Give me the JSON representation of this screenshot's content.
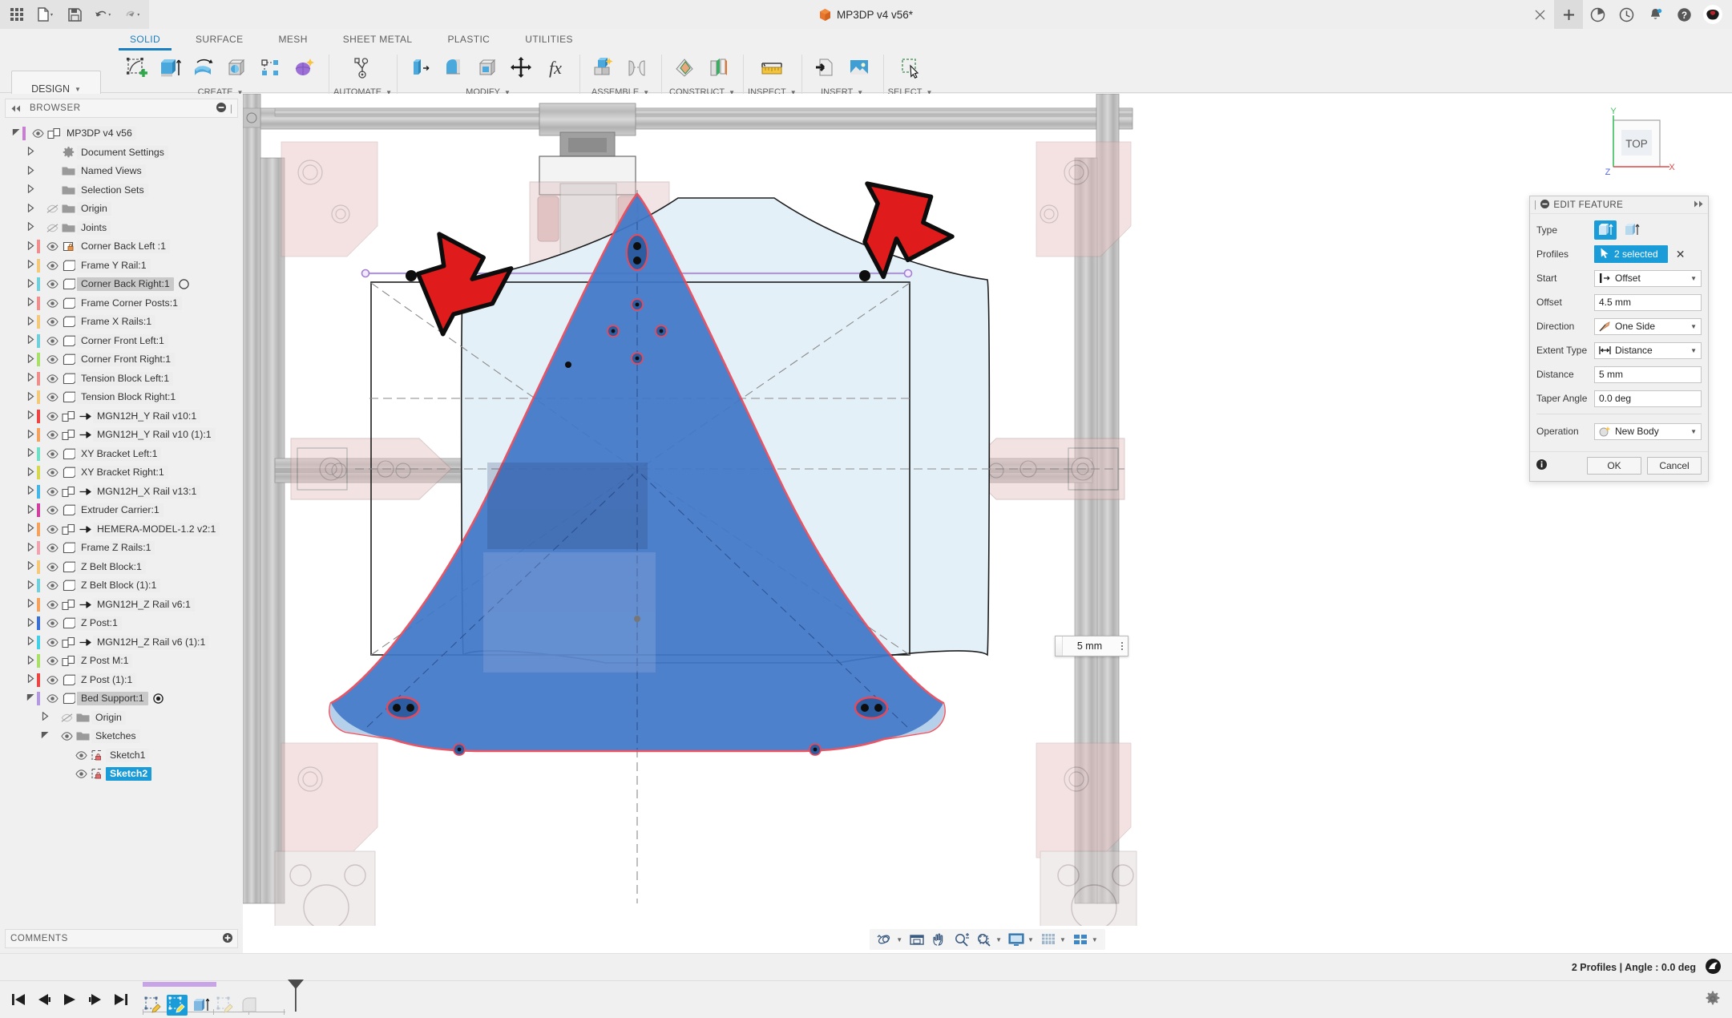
{
  "window": {
    "document_title": "MP3DP v4 v56*",
    "quick_access": [
      {
        "name": "app-grid-icon",
        "label": "Apps"
      },
      {
        "name": "new-file-icon",
        "label": "New"
      },
      {
        "name": "save-icon",
        "label": "Save"
      },
      {
        "name": "undo-icon",
        "label": "Undo"
      },
      {
        "name": "redo-icon",
        "label": "Redo"
      }
    ],
    "controls": [
      {
        "name": "close-tab-button",
        "label": "×"
      },
      {
        "name": "new-tab-button",
        "label": "+"
      },
      {
        "name": "job-status-icon",
        "label": "Job Status"
      },
      {
        "name": "recent-icon",
        "label": "Recent"
      },
      {
        "name": "notifications-icon",
        "label": "Notifications"
      },
      {
        "name": "help-icon",
        "label": "Help"
      },
      {
        "name": "account-avatar",
        "label": "Account"
      }
    ]
  },
  "ribbon": {
    "design_label": "DESIGN",
    "tabs": [
      {
        "label": "SOLID",
        "active": true
      },
      {
        "label": "SURFACE",
        "active": false
      },
      {
        "label": "MESH",
        "active": false
      },
      {
        "label": "SHEET METAL",
        "active": false
      },
      {
        "label": "PLASTIC",
        "active": false
      },
      {
        "label": "UTILITIES",
        "active": false
      }
    ],
    "panels": [
      {
        "label": "CREATE",
        "items": [
          "create-sketch-icon",
          "extrude-icon",
          "revolve-icon",
          "sweep-icon",
          "pattern-icon",
          "form-icon"
        ]
      },
      {
        "label": "AUTOMATE",
        "items": [
          "automate-icon"
        ]
      },
      {
        "label": "MODIFY",
        "items": [
          "press-pull-icon",
          "fillet-icon",
          "shell-icon",
          "move-copy-icon",
          "change-parameters-icon"
        ]
      },
      {
        "label": "ASSEMBLE",
        "items": [
          "new-component-icon",
          "joint-icon"
        ]
      },
      {
        "label": "CONSTRUCT",
        "items": [
          "offset-plane-icon",
          "plane-at-angle-icon"
        ]
      },
      {
        "label": "INSPECT",
        "items": [
          "measure-icon"
        ]
      },
      {
        "label": "INSERT",
        "items": [
          "insert-derive-icon",
          "insert-canvas-icon"
        ]
      },
      {
        "label": "SELECT",
        "items": [
          "select-window-icon"
        ]
      }
    ]
  },
  "browser": {
    "header_label": "BROWSER",
    "collapse_icon": "collapse-left-icon",
    "minus_icon": "minus-circle-icon",
    "items": [
      {
        "label": "MP3DP v4 v56",
        "indent": 0,
        "arrow": "down",
        "color": "#c77fd0",
        "eye": true,
        "icon": "component-icon",
        "badge": null,
        "state": "normal"
      },
      {
        "label": "Document Settings",
        "indent": 1,
        "arrow": "right",
        "color": null,
        "eye": false,
        "icon": "gear-icon",
        "badge": null,
        "state": "normal"
      },
      {
        "label": "Named Views",
        "indent": 1,
        "arrow": "right",
        "color": null,
        "eye": false,
        "icon": "folder-icon",
        "badge": null,
        "state": "normal"
      },
      {
        "label": "Selection Sets",
        "indent": 1,
        "arrow": "right",
        "color": null,
        "eye": false,
        "icon": "folder-icon",
        "badge": null,
        "state": "normal"
      },
      {
        "label": "Origin",
        "indent": 1,
        "arrow": "right",
        "color": null,
        "eye": "off",
        "icon": "folder-icon",
        "badge": null,
        "state": "normal"
      },
      {
        "label": "Joints",
        "indent": 1,
        "arrow": "right",
        "color": null,
        "eye": "off",
        "icon": "folder-icon",
        "badge": null,
        "state": "normal"
      },
      {
        "label": "Corner Back Left :1",
        "indent": 1,
        "arrow": "right",
        "color": "#f08d8d",
        "eye": true,
        "icon": "body-locked-icon",
        "badge": null,
        "state": "normal"
      },
      {
        "label": "Frame Y Rail:1",
        "indent": 1,
        "arrow": "right",
        "color": "#f5c97a",
        "eye": true,
        "icon": "body-icon",
        "badge": null,
        "state": "normal"
      },
      {
        "label": "Corner Back Right:1",
        "indent": 1,
        "arrow": "right",
        "color": "#6fd0dd",
        "eye": true,
        "icon": "body-icon",
        "badge": "circle",
        "state": "sel"
      },
      {
        "label": "Frame Corner Posts:1",
        "indent": 1,
        "arrow": "right",
        "color": "#f08d8d",
        "eye": true,
        "icon": "body-icon",
        "badge": null,
        "state": "normal"
      },
      {
        "label": "Frame X Rails:1",
        "indent": 1,
        "arrow": "right",
        "color": "#f5c97a",
        "eye": true,
        "icon": "body-icon",
        "badge": null,
        "state": "normal"
      },
      {
        "label": "Corner Front Left:1",
        "indent": 1,
        "arrow": "right",
        "color": "#6fd0dd",
        "eye": true,
        "icon": "body-icon",
        "badge": null,
        "state": "normal"
      },
      {
        "label": "Corner Front Right:1",
        "indent": 1,
        "arrow": "right",
        "color": "#a8e06a",
        "eye": true,
        "icon": "body-icon",
        "badge": null,
        "state": "normal"
      },
      {
        "label": "Tension Block Left:1",
        "indent": 1,
        "arrow": "right",
        "color": "#f08d8d",
        "eye": true,
        "icon": "body-icon",
        "badge": null,
        "state": "normal"
      },
      {
        "label": "Tension Block Right:1",
        "indent": 1,
        "arrow": "right",
        "color": "#f5c97a",
        "eye": true,
        "icon": "body-icon",
        "badge": null,
        "state": "normal"
      },
      {
        "label": "MGN12H_Y Rail v10:1",
        "indent": 1,
        "arrow": "right",
        "color": "#ef4444",
        "eye": true,
        "icon": "component-icon",
        "badge": "joint",
        "state": "normal"
      },
      {
        "label": "MGN12H_Y Rail v10 (1):1",
        "indent": 1,
        "arrow": "right",
        "color": "#f5a25d",
        "eye": true,
        "icon": "component-icon",
        "badge": "joint",
        "state": "normal"
      },
      {
        "label": "XY Bracket Left:1",
        "indent": 1,
        "arrow": "right",
        "color": "#6fe0c8",
        "eye": true,
        "icon": "body-icon",
        "badge": null,
        "state": "normal"
      },
      {
        "label": "XY Bracket Right:1",
        "indent": 1,
        "arrow": "right",
        "color": "#d6d84e",
        "eye": true,
        "icon": "body-icon",
        "badge": null,
        "state": "normal"
      },
      {
        "label": "MGN12H_X Rail v13:1",
        "indent": 1,
        "arrow": "right",
        "color": "#44b6e8",
        "eye": true,
        "icon": "component-icon",
        "badge": "joint",
        "state": "normal"
      },
      {
        "label": "Extruder Carrier:1",
        "indent": 1,
        "arrow": "right",
        "color": "#d13fa0",
        "eye": true,
        "icon": "body-icon",
        "badge": null,
        "state": "normal"
      },
      {
        "label": "HEMERA-MODEL-1.2 v2:1",
        "indent": 1,
        "arrow": "right",
        "color": "#f5a25d",
        "eye": true,
        "icon": "component-icon",
        "badge": "joint",
        "state": "normal"
      },
      {
        "label": "Frame Z Rails:1",
        "indent": 1,
        "arrow": "right",
        "color": "#f2a3b0",
        "eye": true,
        "icon": "body-icon",
        "badge": null,
        "state": "normal"
      },
      {
        "label": "Z Belt Block:1",
        "indent": 1,
        "arrow": "right",
        "color": "#f5c97a",
        "eye": true,
        "icon": "body-icon",
        "badge": null,
        "state": "normal"
      },
      {
        "label": "Z Belt Block (1):1",
        "indent": 1,
        "arrow": "right",
        "color": "#6fd0dd",
        "eye": true,
        "icon": "body-icon",
        "badge": null,
        "state": "normal"
      },
      {
        "label": "MGN12H_Z Rail v6:1",
        "indent": 1,
        "arrow": "right",
        "color": "#f5a25d",
        "eye": true,
        "icon": "component-icon",
        "badge": "joint",
        "state": "normal"
      },
      {
        "label": "Z Post:1",
        "indent": 1,
        "arrow": "right",
        "color": "#3b6fd4",
        "eye": true,
        "icon": "body-icon",
        "badge": null,
        "state": "normal"
      },
      {
        "label": "MGN12H_Z Rail v6 (1):1",
        "indent": 1,
        "arrow": "right",
        "color": "#44cfe8",
        "eye": true,
        "icon": "component-icon",
        "badge": "joint",
        "state": "normal"
      },
      {
        "label": "Z Post M:1",
        "indent": 1,
        "arrow": "right",
        "color": "#a8e06a",
        "eye": true,
        "icon": "component-icon",
        "badge": null,
        "state": "normal"
      },
      {
        "label": "Z Post (1):1",
        "indent": 1,
        "arrow": "right",
        "color": "#ef4444",
        "eye": true,
        "icon": "body-icon",
        "badge": null,
        "state": "normal"
      },
      {
        "label": "Bed Support:1",
        "indent": 1,
        "arrow": "down",
        "color": "#b39ae0",
        "eye": true,
        "icon": "body-icon",
        "badge": "target",
        "state": "sel"
      },
      {
        "label": "Origin",
        "indent": 2,
        "arrow": "right",
        "color": null,
        "eye": "off",
        "icon": "folder-icon",
        "badge": null,
        "state": "normal"
      },
      {
        "label": "Sketches",
        "indent": 2,
        "arrow": "down",
        "color": null,
        "eye": true,
        "icon": "folder-icon",
        "badge": null,
        "state": "normal"
      },
      {
        "label": "Sketch1",
        "indent": 3,
        "arrow": "none",
        "color": null,
        "eye": true,
        "icon": "sketch-icon",
        "badge": null,
        "state": "normal"
      },
      {
        "label": "Sketch2",
        "indent": 3,
        "arrow": "none",
        "color": null,
        "eye": true,
        "icon": "sketch-icon",
        "badge": null,
        "state": "selblue"
      }
    ],
    "comments_label": "COMMENTS",
    "comments_add_icon": "plus-circle-icon"
  },
  "dialog": {
    "title": "EDIT FEATURE",
    "collapse_icon": "minus-circle-icon",
    "expand_icon": "chevrons-right-icon",
    "type_label": "Type",
    "type_options": [
      "extrude-profile-icon",
      "extrude-surface-icon"
    ],
    "type_selected_index": 0,
    "profiles_label": "Profiles",
    "profiles_value": "2 selected",
    "profiles_clear_icon": "x-icon",
    "start_label": "Start",
    "start_value": "Offset",
    "start_icon": "start-offset-icon",
    "offset_label": "Offset",
    "offset_value": "4.5 mm",
    "direction_label": "Direction",
    "direction_value": "One Side",
    "direction_icon": "direction-one-side-icon",
    "extent_type_label": "Extent Type",
    "extent_type_value": "Distance",
    "extent_type_icon": "distance-icon",
    "distance_label": "Distance",
    "distance_value": "5 mm",
    "taper_label": "Taper Angle",
    "taper_value": "0.0 deg",
    "operation_label": "Operation",
    "operation_value": "New Body",
    "operation_icon": "new-body-icon",
    "info_icon": "info-icon",
    "ok_label": "OK",
    "cancel_label": "Cancel"
  },
  "canvas": {
    "viewcube_face": "TOP",
    "axis_x": "X",
    "axis_y": "Y",
    "axis_z": "Z",
    "dimension_value": "5 mm",
    "annotations": [
      {
        "name": "red-arrow-left",
        "direction": "down-right"
      },
      {
        "name": "red-arrow-right",
        "direction": "down-left"
      }
    ],
    "colors": {
      "selected_face": "#4178c8",
      "profile_highlight": "#e8495a",
      "preview_face": "#e4f0f8",
      "sketch_line": "#b09ad6",
      "annotation_arrow": "#e01b1b"
    }
  },
  "nav_toolbar": {
    "items": [
      {
        "name": "orbit-icon",
        "label": "Orbit",
        "dropdown": true
      },
      {
        "name": "pan-view-icon",
        "label": "Look At",
        "dropdown": false
      },
      {
        "name": "pan-icon",
        "label": "Pan",
        "dropdown": false
      },
      {
        "name": "zoom-icon",
        "label": "Zoom",
        "dropdown": false
      },
      {
        "name": "zoom-window-icon",
        "label": "Fit",
        "dropdown": true
      },
      {
        "name": "display-settings-icon",
        "label": "Display Settings",
        "dropdown": true
      },
      {
        "name": "grid-snaps-icon",
        "label": "Grid and Snaps",
        "dropdown": true
      },
      {
        "name": "viewports-icon",
        "label": "Viewports",
        "dropdown": true
      }
    ]
  },
  "statusbar": {
    "text": "2 Profiles | Angle : 0.0 deg",
    "icon": "autodesk-logo-icon",
    "settings_icon": "settings-gear-icon"
  },
  "timeline": {
    "playback": [
      {
        "name": "timeline-go-start-button",
        "label": "Go to beginning"
      },
      {
        "name": "timeline-step-back-button",
        "label": "Step back"
      },
      {
        "name": "timeline-play-button",
        "label": "Play"
      },
      {
        "name": "timeline-step-forward-button",
        "label": "Step forward"
      },
      {
        "name": "timeline-go-end-button",
        "label": "Go to end"
      }
    ],
    "features": [
      {
        "name": "timeline-feature-sketch1",
        "icon": "sketch-feature-icon",
        "active": false
      },
      {
        "name": "timeline-feature-sketch2",
        "icon": "sketch-feature-icon",
        "active": true
      },
      {
        "name": "timeline-feature-extrude",
        "icon": "extrude-feature-icon",
        "active": false
      },
      {
        "name": "timeline-feature-sketch3",
        "icon": "sketch-feature-icon",
        "active": false
      },
      {
        "name": "timeline-feature-fillet",
        "icon": "fillet-feature-icon",
        "active": false
      }
    ],
    "group_color": "#c9a3e8"
  }
}
